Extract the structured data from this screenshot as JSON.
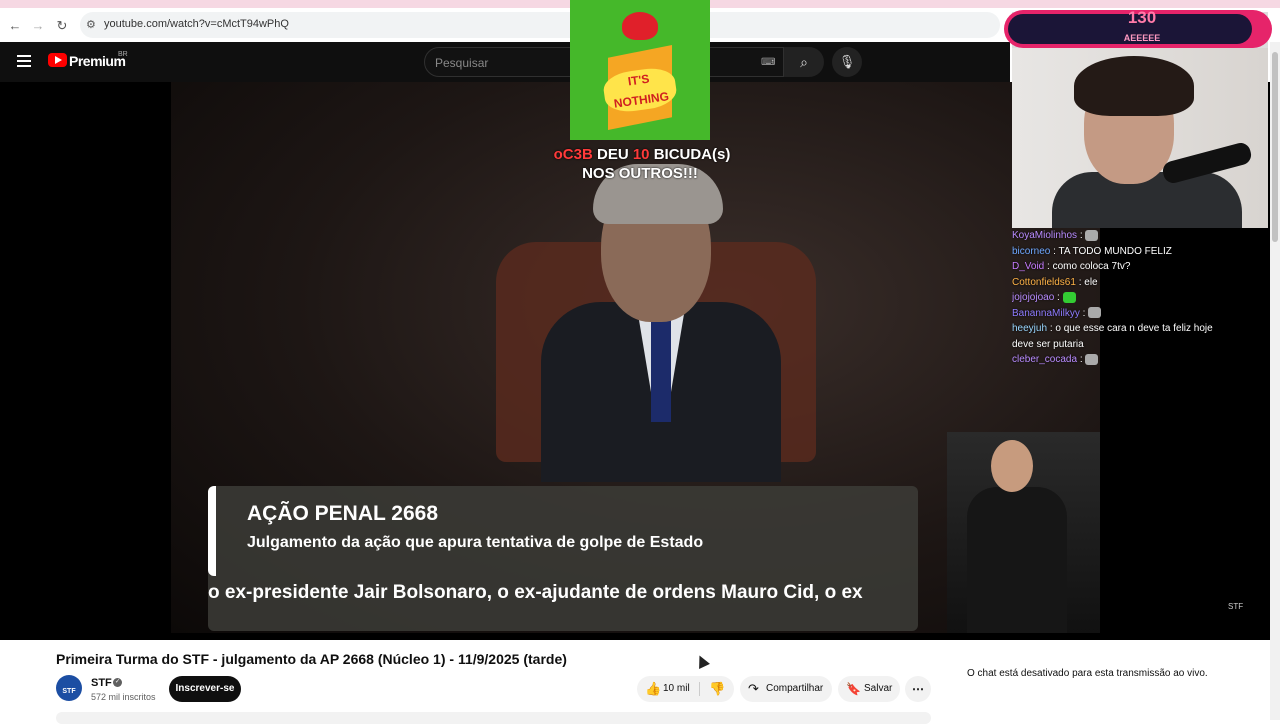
{
  "browser": {
    "url": "youtube.com/watch?v=cMctT94wPhQ",
    "back_icon": "arrow-left-icon",
    "forward_icon": "arrow-right-icon",
    "reload_icon": "reload-icon"
  },
  "header": {
    "logo_text": "Premium",
    "region": "BR",
    "search_placeholder": "Pesquisar"
  },
  "gift_overlay": {
    "badge_text": "IT'S NOTHING",
    "alert_user": "oC3B",
    "alert_mid": "DEU",
    "alert_count": "10",
    "alert_item": "BICUDA(s)",
    "alert_line2": "NOS OUTROS!!!"
  },
  "webcam": {
    "counter": "130",
    "counter_label": "AEEEEE"
  },
  "chat": {
    "messages": [
      {
        "user": "KoyaMiolinhos",
        "color": "#b98cff",
        "text": ":"
      },
      {
        "user": "bicorneo",
        "color": "#6fa8ff",
        "text": ": TA TODO MUNDO FELIZ"
      },
      {
        "user": "D_Void",
        "color": "#c67cff",
        "text": ": como coloca 7tv?"
      },
      {
        "user": "Cottonfields61",
        "color": "#ffb347",
        "text": ":  ele"
      },
      {
        "user": "jojojojoao",
        "color": "#b98cff",
        "text": ":"
      },
      {
        "user": "BanannaMilkyy",
        "color": "#8f7cff",
        "text": ":"
      },
      {
        "user": "heeyjuh",
        "color": "#9ad7ff",
        "text": ": o que esse cara n deve ta feliz hoje"
      },
      {
        "user": "",
        "color": "#ffffff",
        "text": "deve ser putaria"
      },
      {
        "user": "cleber_cocada",
        "color": "#b98cff",
        "text": ":"
      }
    ]
  },
  "video": {
    "lower_title": "AÇÃO PENAL 2668",
    "lower_subtitle": "Julgamento da ação que apura tentativa de golpe de Estado",
    "ticker": "o ex-presidente Jair Bolsonaro, o ex-ajudante de ordens Mauro Cid, o ex",
    "watermark": "STF"
  },
  "meta": {
    "title": "Primeira Turma do STF - julgamento da AP 2668 (Núcleo 1) - 11/9/2025 (tarde)",
    "channel": "STF",
    "channel_avatar_text": "STF",
    "subscribers": "572 mil inscritos",
    "subscribe_label": "Inscrever-se",
    "likes": "10 mil",
    "share_label": "Compartilhar",
    "save_label": "Salvar",
    "more_label": "⋯",
    "chat_disabled": "O chat está desativado para esta transmissão ao vivo."
  }
}
